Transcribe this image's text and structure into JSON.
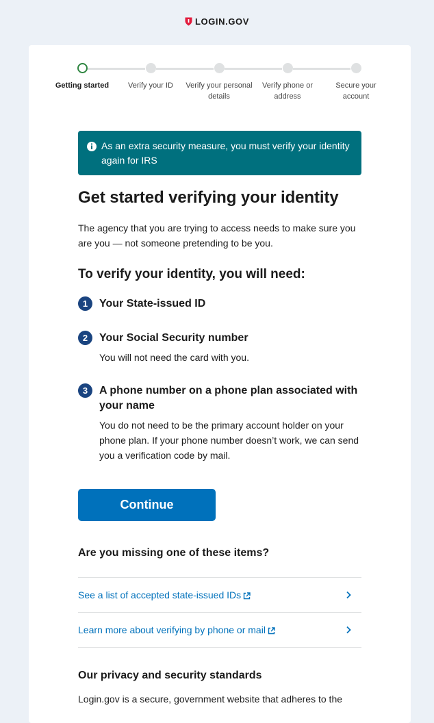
{
  "header": {
    "brand": "LOGIN.GOV"
  },
  "steps": [
    {
      "label": "Getting started",
      "state": "current"
    },
    {
      "label": "Verify your ID",
      "state": "upcoming"
    },
    {
      "label": "Verify your personal details",
      "state": "upcoming"
    },
    {
      "label": "Verify phone or address",
      "state": "upcoming"
    },
    {
      "label": "Secure your account",
      "state": "upcoming"
    }
  ],
  "alert": {
    "icon": "info-icon",
    "text": "As an extra security measure, you must verify your identity again for IRS"
  },
  "main": {
    "title": "Get started verifying your identity",
    "intro": "The agency that you are trying to access needs to make sure you are you — not someone pretending to be you.",
    "subhead": "To verify your identity, you will need:",
    "requirements": [
      {
        "num": "1",
        "title": "Your State-issued ID",
        "desc": ""
      },
      {
        "num": "2",
        "title": "Your Social Security number",
        "desc": "You will not need the card with you."
      },
      {
        "num": "3",
        "title": "A phone number on a phone plan associated with your name",
        "desc": "You do not need to be the primary account holder on your phone plan. If your phone number doesn’t work, we can send you a verification code by mail."
      }
    ],
    "continue_label": "Continue",
    "missing_head": "Are you missing one of these items?",
    "links": [
      {
        "label": "See a list of accepted state-issued IDs"
      },
      {
        "label": "Learn more about verifying by phone or mail"
      }
    ],
    "privacy_head": "Our privacy and security standards",
    "privacy_text": "Login.gov is a secure, government website that adheres to the"
  },
  "colors": {
    "background": "#ecf1f7",
    "alert": "#00707e",
    "primary": "#0071bb",
    "step_current": "#2e8540",
    "number_badge": "#1a4480"
  }
}
